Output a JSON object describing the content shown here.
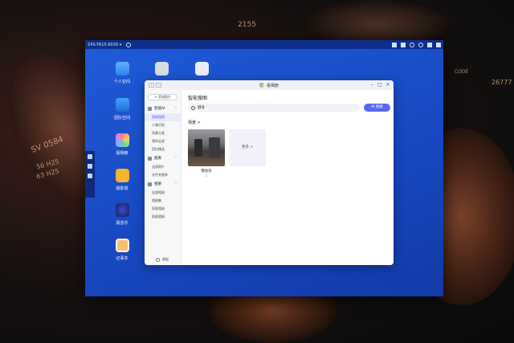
{
  "wallpaper": {
    "texts": [
      "2155",
      "SV 0584",
      "56 H25",
      "63 H25",
      "26777",
      "CODE"
    ]
  },
  "desktop": {
    "hostname": "Z4S-TA15-6026",
    "hostname_suffix": "▾",
    "apps": [
      {
        "label": "个人空间",
        "icon": "folder-icon"
      },
      {
        "label": "团队空间",
        "icon": "shared-folder-icon"
      },
      {
        "label": "极相册",
        "icon": "photo-app-icon"
      },
      {
        "label": "极影视",
        "icon": "video-app-icon"
      },
      {
        "label": "极音乐",
        "icon": "music-app-icon"
      },
      {
        "label": "记事本",
        "icon": "notepad-icon"
      }
    ],
    "top_apps": [
      {
        "label": "",
        "icon": "disc-icon"
      },
      {
        "label": "",
        "icon": "trash-icon"
      }
    ]
  },
  "photo_window": {
    "title": "极相册",
    "nav_back": "‹",
    "nav_forward": "›",
    "sidebar": {
      "add_button": "+ 添加照片",
      "groups": [
        {
          "label": "智能AI",
          "chevron": "^",
          "items": [
            "智能搜图",
            "人像识别",
            "场景分类",
            "我的足迹",
            "回忆精选"
          ]
        },
        {
          "label": "图库",
          "chevron": "^",
          "items": [
            "全部照片",
            "文件夹图库"
          ]
        },
        {
          "label": "相册",
          "chevron": "^",
          "items": [
            "全部相册",
            "相册集",
            "家庭相册",
            "家庭相册"
          ]
        }
      ],
      "collapse_label": "收起"
    },
    "main": {
      "page_title": "智能搜图",
      "search_value": "健身",
      "ai_button": "AI 搜索",
      "section_title": "场景 >",
      "thumb_label": "健身房",
      "thumb_count": "1",
      "more_label": "更多 >"
    }
  }
}
